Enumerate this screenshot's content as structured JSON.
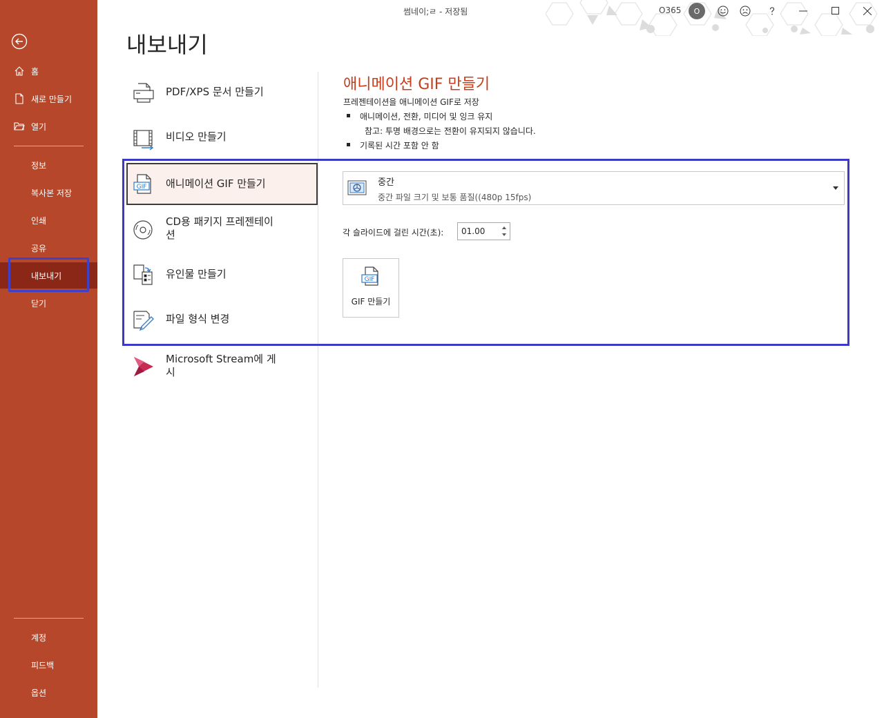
{
  "window": {
    "title": "썸네이;ㄹ  -  저장됨",
    "account": "O365",
    "avatar_initial": "O"
  },
  "sidebar": {
    "top_items": [
      {
        "label": "홈",
        "icon": "home-icon"
      },
      {
        "label": "새로 만들기",
        "icon": "new-document-icon"
      },
      {
        "label": "열기",
        "icon": "folder-open-icon"
      }
    ],
    "middle_items": [
      "정보",
      "복사본 저장",
      "인쇄",
      "공유",
      "내보내기",
      "닫기"
    ],
    "active_item": "내보내기",
    "bottom_items": [
      "계정",
      "피드백",
      "옵션"
    ],
    "bg_color": "#b7472a",
    "active_color": "#8b2716"
  },
  "main": {
    "title": "내보내기",
    "options": [
      {
        "label": "PDF/XPS 문서 만들기",
        "icon": "pdf-xps-icon"
      },
      {
        "label": "비디오 만들기",
        "icon": "video-icon"
      },
      {
        "label": "애니메이션 GIF 만들기",
        "icon": "gif-icon",
        "selected": true
      },
      {
        "label": "CD용 패키지 프레젠테이션",
        "icon": "cd-package-icon"
      },
      {
        "label": "유인물 만들기",
        "icon": "handouts-icon"
      },
      {
        "label": "파일 형식 변경",
        "icon": "change-file-type-icon"
      },
      {
        "label": "Microsoft Stream에 게시",
        "icon": "microsoft-stream-icon"
      }
    ]
  },
  "detail": {
    "title": "애니메이션 GIF 만들기",
    "description": "프레젠테이션을 애니메이션 GIF로 저장",
    "bullets": [
      "애니메이션, 전환, 미디어 및 잉크 유지",
      "기록된 시간 포함 안 함"
    ],
    "note": "참고: 투명 배경으로는 전환이 유지되지 않습니다.",
    "quality": {
      "title": "중간",
      "subtitle": "중간 파일 크기 및 보통 품질((480p 15fps)"
    },
    "seconds_label": "각 슬라이드에 걸린 시간(초):",
    "seconds_value": "01.00",
    "create_button": "GIF 만들기",
    "accent_color": "#c43e1c",
    "highlight_color": "#3a3ac4"
  }
}
